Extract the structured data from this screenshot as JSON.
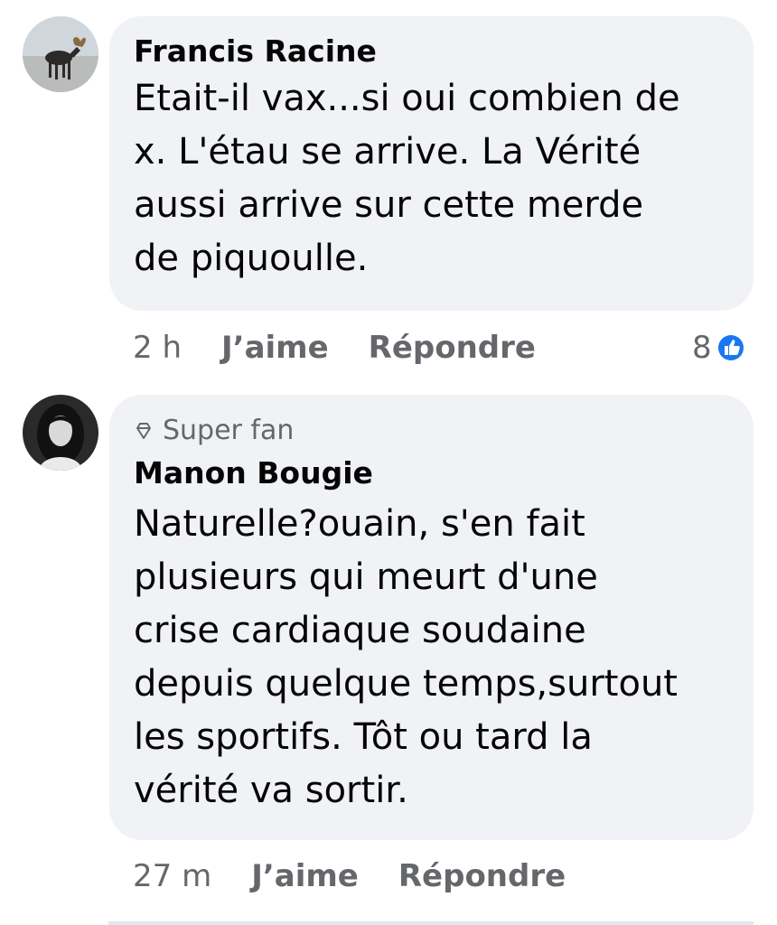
{
  "comments": [
    {
      "author": "Francis Racine",
      "text_lines": [
        "Etait-il vax...si oui combien de",
        "x. L'étau se arrive. La Vérité",
        "aussi arrive sur cette merde",
        "de piquoulle."
      ],
      "time": "2 h",
      "like_label": "J’aime",
      "reply_label": "Répondre",
      "reaction_count": "8",
      "avatar_icon": "moose-avatar-icon"
    },
    {
      "badge": "Super fan",
      "badge_icon": "diamond-icon",
      "author": "Manon Bougie",
      "text_lines": [
        "Naturelle?ouain, s'en fait",
        "plusieurs qui meurt d'une",
        "crise cardiaque soudaine",
        "depuis quelque temps,surtout",
        "les sportifs. Tôt ou tard la",
        "vérité va sortir."
      ],
      "time": "27 m",
      "like_label": "J’aime",
      "reply_label": "Répondre",
      "avatar_icon": "woman-avatar-icon"
    }
  ],
  "colors": {
    "bubble": "#f0f2f5",
    "text": "#050505",
    "secondary": "#65676b",
    "like_blue": "#1877f2"
  }
}
